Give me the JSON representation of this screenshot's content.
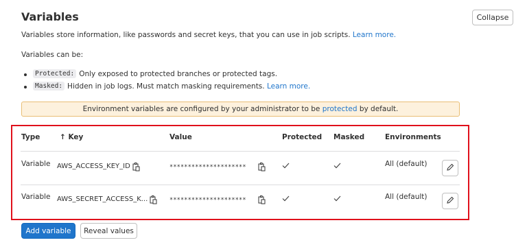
{
  "section": {
    "title": "Variables",
    "collapse_label": "Collapse",
    "description": "Variables store information, like passwords and secret keys, that you can use in job scripts.",
    "description_link": "Learn more.",
    "can_be": "Variables can be:",
    "bullets": [
      {
        "code": "Protected:",
        "text": "Only exposed to protected branches or protected tags.",
        "link": ""
      },
      {
        "code": "Masked:",
        "text": "Hidden in job logs. Must match masking requirements.",
        "link": "Learn more."
      }
    ]
  },
  "banner": {
    "text_before": "Environment variables are configured by your administrator to be",
    "link": "protected",
    "text_after": "by default."
  },
  "table": {
    "headers": {
      "type": "Type",
      "key": "↑ Key",
      "value": "Value",
      "protected": "Protected",
      "masked": "Masked",
      "environments": "Environments"
    },
    "rows": [
      {
        "type": "Variable",
        "key": "AWS_ACCESS_KEY_ID",
        "value": "*********************",
        "protected": true,
        "masked": true,
        "environments": "All (default)"
      },
      {
        "type": "Variable",
        "key": "AWS_SECRET_ACCESS_K...",
        "value": "*********************",
        "protected": true,
        "masked": true,
        "environments": "All (default)"
      }
    ]
  },
  "actions": {
    "add_label": "Add variable",
    "reveal_label": "Reveal values"
  },
  "colors": {
    "primary": "#1f75cb",
    "highlight_border": "#e0101b",
    "banner_bg": "#fdf1dd",
    "banner_border": "#e9be74"
  },
  "icons": [
    "copy-icon",
    "check-icon",
    "pencil-icon"
  ]
}
